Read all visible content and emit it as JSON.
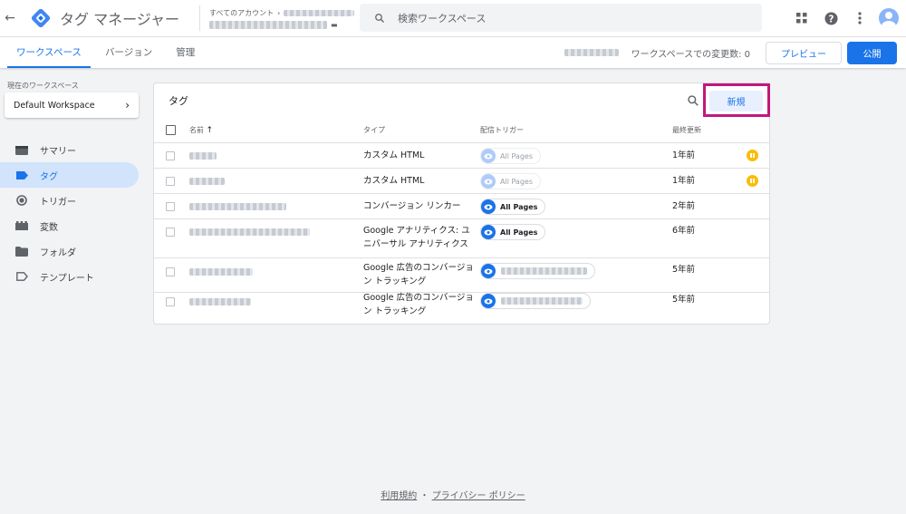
{
  "app": {
    "title": "タグ マネージャー",
    "breadcrumb": "すべてのアカウント",
    "back_icon": "arrow-back-icon",
    "logo_icon": "gtm-logo-icon"
  },
  "search": {
    "placeholder": "検索ワークスペース"
  },
  "header_icons": [
    "apps-grid-icon",
    "help-icon",
    "more-vert-icon",
    "account-avatar-icon"
  ],
  "tabs": [
    {
      "label": "ワークスペース",
      "active": true
    },
    {
      "label": "バージョン",
      "active": false
    },
    {
      "label": "管理",
      "active": false
    }
  ],
  "workspace_changes": "ワークスペースでの変更数: 0",
  "buttons": {
    "preview": "プレビュー",
    "publish": "公開",
    "new": "新規"
  },
  "sidebar": {
    "current_label": "現在のワークスペース",
    "workspace_name": "Default Workspace",
    "items": [
      {
        "label": "サマリー",
        "icon": "summary-icon",
        "active": false
      },
      {
        "label": "タグ",
        "icon": "tag-icon",
        "active": true
      },
      {
        "label": "トリガー",
        "icon": "trigger-icon",
        "active": false
      },
      {
        "label": "変数",
        "icon": "variables-icon",
        "active": false
      },
      {
        "label": "フォルダ",
        "icon": "folder-icon",
        "active": false
      },
      {
        "label": "テンプレート",
        "icon": "template-icon",
        "active": false
      }
    ]
  },
  "tags_panel": {
    "title": "タグ",
    "columns": {
      "name": "名前",
      "type": "タイプ",
      "trigger": "配信トリガー",
      "updated": "最終更新"
    },
    "rows": [
      {
        "type": "カスタム HTML",
        "trigger": "All Pages",
        "trigger_dim": true,
        "updated": "1年前",
        "paused": true
      },
      {
        "type": "カスタム HTML",
        "trigger": "All Pages",
        "trigger_dim": true,
        "updated": "1年前",
        "paused": true
      },
      {
        "type": "コンバージョン リンカー",
        "trigger": "All Pages",
        "trigger_dim": false,
        "updated": "2年前",
        "paused": false
      },
      {
        "type": "Google アナリティクス: ユニバーサル アナリティクス",
        "trigger": "All Pages",
        "trigger_dim": false,
        "updated": "6年前",
        "paused": false
      },
      {
        "type": "Google 広告のコンバージョン トラッキング",
        "trigger": "",
        "trigger_dim": false,
        "updated": "5年前",
        "paused": false
      },
      {
        "type": "Google 広告のコンバージョン トラッキング",
        "trigger": "",
        "trigger_dim": false,
        "updated": "5年前",
        "paused": false
      }
    ]
  },
  "footer": {
    "terms": "利用規約",
    "separator": "・",
    "privacy": "プライバシー ポリシー"
  },
  "colors": {
    "accent": "#1a73e8",
    "highlight": "#c2187b",
    "paused": "#fbbc04"
  }
}
